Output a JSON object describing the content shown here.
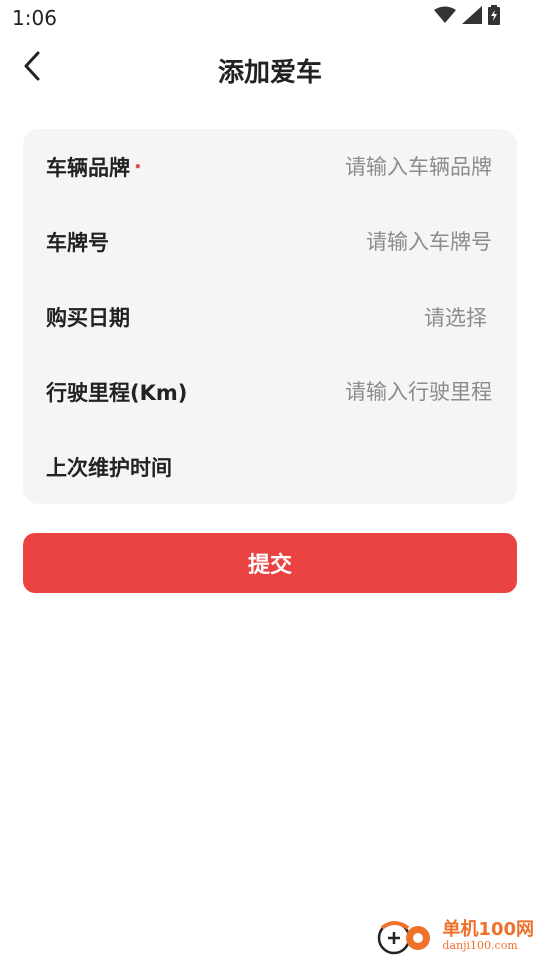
{
  "status": {
    "time": "1:06"
  },
  "header": {
    "title": "添加爱车"
  },
  "form": {
    "brand": {
      "label": "车辆品牌",
      "required_mark": "•",
      "placeholder": "请输入车辆品牌"
    },
    "plate": {
      "label": "车牌号",
      "placeholder": "请输入车牌号"
    },
    "purchase_date": {
      "label": "购买日期",
      "value": "请选择"
    },
    "mileage": {
      "label": "行驶里程(Km)",
      "placeholder": "请输入行驶里程"
    },
    "last_maintenance": {
      "label": "上次维护时间"
    }
  },
  "submit_label": "提交",
  "watermark": {
    "title": "单机100网",
    "url": "danji100.com"
  },
  "colors": {
    "accent": "#ea4342",
    "card_bg": "#f5f5f5",
    "watermark": "#f0712a"
  }
}
